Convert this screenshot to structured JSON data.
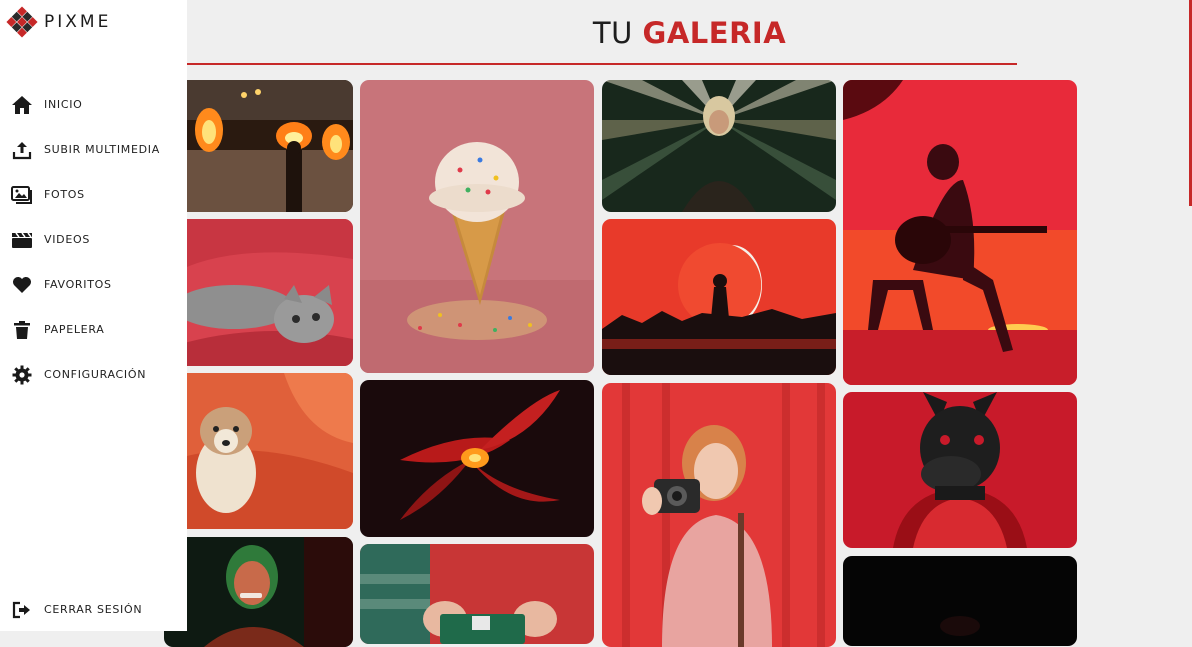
{
  "brand": {
    "name": "PIXME"
  },
  "header": {
    "title_part1": "TU ",
    "title_part2": "GALERIA"
  },
  "sidebar": {
    "items": [
      {
        "label": "INICIO",
        "icon": "home-icon"
      },
      {
        "label": "SUBIR MULTIMEDIA",
        "icon": "upload-icon"
      },
      {
        "label": "FOTOS",
        "icon": "photos-icon"
      },
      {
        "label": "VIDEOS",
        "icon": "clapperboard-icon"
      },
      {
        "label": "FAVORITOS",
        "icon": "heart-icon"
      },
      {
        "label": "PAPELERA",
        "icon": "trash-icon"
      },
      {
        "label": "CONFIGURACIÓN",
        "icon": "gear-icon"
      }
    ],
    "logout": {
      "label": "CERRAR SESIÓN",
      "icon": "logout-icon"
    }
  },
  "colors": {
    "accent": "#c62828",
    "background": "#efefef",
    "sidebar": "#ffffff",
    "text": "#1e1e1e"
  },
  "gallery": {
    "photos": [
      "fire-performers",
      "gray-kitten",
      "puppy",
      "woman-green-light",
      "ice-cream-cone",
      "red-flower",
      "hands-camera",
      "woman-sunburst",
      "sunset-silhouette",
      "woman-with-camera",
      "guitarist-red-sky",
      "dog-mask-person",
      "dark-photo"
    ]
  }
}
